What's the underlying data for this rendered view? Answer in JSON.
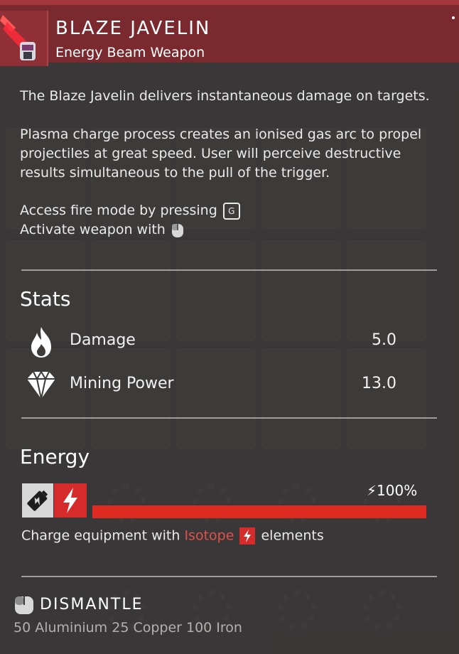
{
  "item": {
    "name": "BLAZE JAVELIN",
    "type": "Energy Beam Weapon"
  },
  "description": {
    "line1": "The Blaze Javelin delivers instantaneous damage on targets.",
    "line2": "Plasma charge process creates an ionised gas arc to propel projectiles at great speed. User will perceive destructive results simultaneous to the pull of the trigger.",
    "fire_mode_prefix": "Access fire mode by pressing",
    "fire_mode_key": "G",
    "activate_prefix": "Activate weapon with"
  },
  "stats": {
    "title": "Stats",
    "rows": [
      {
        "label": "Damage",
        "value": "5.0",
        "icon": "flame-icon"
      },
      {
        "label": "Mining Power",
        "value": "13.0",
        "icon": "diamond-icon"
      }
    ]
  },
  "energy": {
    "title": "Energy",
    "percent_label": "100%",
    "fill_fraction": 1.0,
    "charge_prefix": "Charge equipment with",
    "charge_element": "Isotope",
    "charge_suffix": "elements"
  },
  "dismantle": {
    "title": "DISMANTLE",
    "cost": "50 Aluminium 25 Copper 100 Iron"
  },
  "colors": {
    "header_bg": "#7a2a2f",
    "energy_red": "#de2a20",
    "isotope_text": "#e0524c"
  }
}
